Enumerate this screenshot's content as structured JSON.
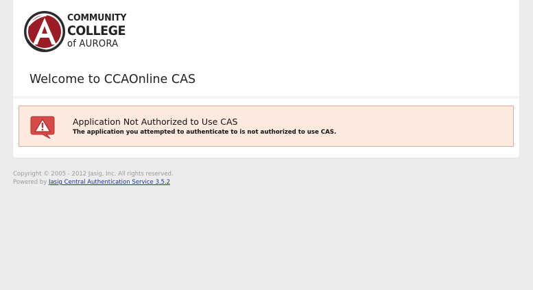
{
  "logo": {
    "line1": "COMMUNITY",
    "line2": "COLLEGE",
    "line3": "of AURORA",
    "emblem_letter": "A",
    "accent_color": "#9c1c25"
  },
  "page": {
    "title": "Welcome to CCAOnline CAS"
  },
  "error": {
    "icon": "warning-triangle-icon",
    "heading": "Application Not Authorized to Use CAS",
    "message": "The application you attempted to authenticate to is not authorized to use CAS.",
    "background_color": "#fdeadf",
    "border_color": "#e8a9a0"
  },
  "footer": {
    "copyright": "Copyright © 2005 - 2012 Jasig, Inc. All rights reserved.",
    "powered_by_prefix": "Powered by",
    "powered_by_link": "Jasig Central Authentication Service 3.5.2"
  }
}
